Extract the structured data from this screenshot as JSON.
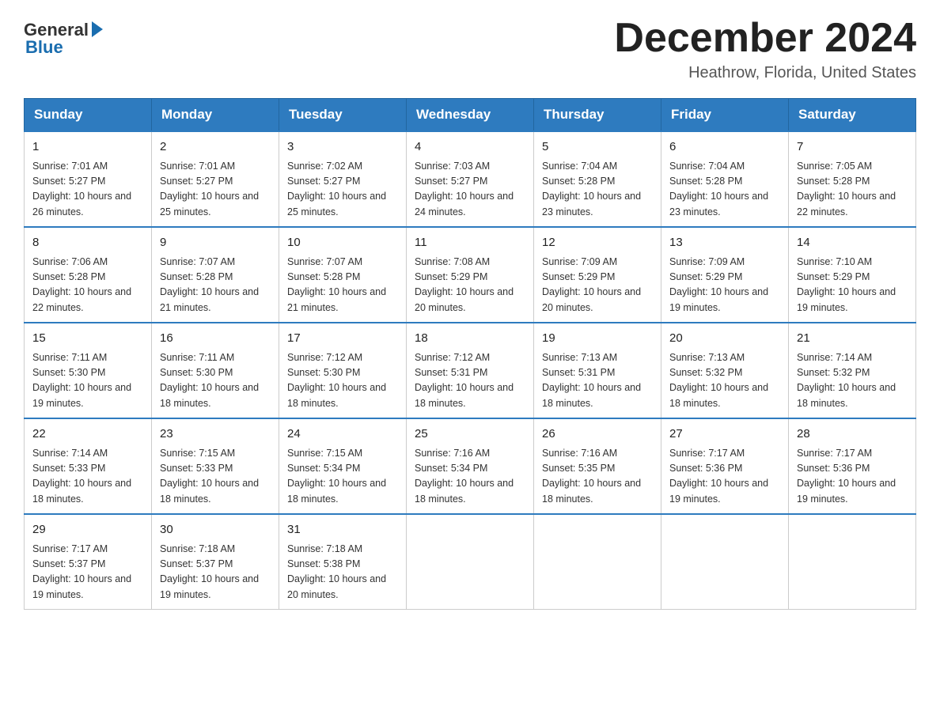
{
  "logo": {
    "general": "General",
    "blue": "Blue"
  },
  "title": {
    "month": "December 2024",
    "location": "Heathrow, Florida, United States"
  },
  "days_of_week": [
    "Sunday",
    "Monday",
    "Tuesday",
    "Wednesday",
    "Thursday",
    "Friday",
    "Saturday"
  ],
  "weeks": [
    [
      {
        "day": "1",
        "sunrise": "7:01 AM",
        "sunset": "5:27 PM",
        "daylight": "10 hours and 26 minutes."
      },
      {
        "day": "2",
        "sunrise": "7:01 AM",
        "sunset": "5:27 PM",
        "daylight": "10 hours and 25 minutes."
      },
      {
        "day": "3",
        "sunrise": "7:02 AM",
        "sunset": "5:27 PM",
        "daylight": "10 hours and 25 minutes."
      },
      {
        "day": "4",
        "sunrise": "7:03 AM",
        "sunset": "5:27 PM",
        "daylight": "10 hours and 24 minutes."
      },
      {
        "day": "5",
        "sunrise": "7:04 AM",
        "sunset": "5:28 PM",
        "daylight": "10 hours and 23 minutes."
      },
      {
        "day": "6",
        "sunrise": "7:04 AM",
        "sunset": "5:28 PM",
        "daylight": "10 hours and 23 minutes."
      },
      {
        "day": "7",
        "sunrise": "7:05 AM",
        "sunset": "5:28 PM",
        "daylight": "10 hours and 22 minutes."
      }
    ],
    [
      {
        "day": "8",
        "sunrise": "7:06 AM",
        "sunset": "5:28 PM",
        "daylight": "10 hours and 22 minutes."
      },
      {
        "day": "9",
        "sunrise": "7:07 AM",
        "sunset": "5:28 PM",
        "daylight": "10 hours and 21 minutes."
      },
      {
        "day": "10",
        "sunrise": "7:07 AM",
        "sunset": "5:28 PM",
        "daylight": "10 hours and 21 minutes."
      },
      {
        "day": "11",
        "sunrise": "7:08 AM",
        "sunset": "5:29 PM",
        "daylight": "10 hours and 20 minutes."
      },
      {
        "day": "12",
        "sunrise": "7:09 AM",
        "sunset": "5:29 PM",
        "daylight": "10 hours and 20 minutes."
      },
      {
        "day": "13",
        "sunrise": "7:09 AM",
        "sunset": "5:29 PM",
        "daylight": "10 hours and 19 minutes."
      },
      {
        "day": "14",
        "sunrise": "7:10 AM",
        "sunset": "5:29 PM",
        "daylight": "10 hours and 19 minutes."
      }
    ],
    [
      {
        "day": "15",
        "sunrise": "7:11 AM",
        "sunset": "5:30 PM",
        "daylight": "10 hours and 19 minutes."
      },
      {
        "day": "16",
        "sunrise": "7:11 AM",
        "sunset": "5:30 PM",
        "daylight": "10 hours and 18 minutes."
      },
      {
        "day": "17",
        "sunrise": "7:12 AM",
        "sunset": "5:30 PM",
        "daylight": "10 hours and 18 minutes."
      },
      {
        "day": "18",
        "sunrise": "7:12 AM",
        "sunset": "5:31 PM",
        "daylight": "10 hours and 18 minutes."
      },
      {
        "day": "19",
        "sunrise": "7:13 AM",
        "sunset": "5:31 PM",
        "daylight": "10 hours and 18 minutes."
      },
      {
        "day": "20",
        "sunrise": "7:13 AM",
        "sunset": "5:32 PM",
        "daylight": "10 hours and 18 minutes."
      },
      {
        "day": "21",
        "sunrise": "7:14 AM",
        "sunset": "5:32 PM",
        "daylight": "10 hours and 18 minutes."
      }
    ],
    [
      {
        "day": "22",
        "sunrise": "7:14 AM",
        "sunset": "5:33 PM",
        "daylight": "10 hours and 18 minutes."
      },
      {
        "day": "23",
        "sunrise": "7:15 AM",
        "sunset": "5:33 PM",
        "daylight": "10 hours and 18 minutes."
      },
      {
        "day": "24",
        "sunrise": "7:15 AM",
        "sunset": "5:34 PM",
        "daylight": "10 hours and 18 minutes."
      },
      {
        "day": "25",
        "sunrise": "7:16 AM",
        "sunset": "5:34 PM",
        "daylight": "10 hours and 18 minutes."
      },
      {
        "day": "26",
        "sunrise": "7:16 AM",
        "sunset": "5:35 PM",
        "daylight": "10 hours and 18 minutes."
      },
      {
        "day": "27",
        "sunrise": "7:17 AM",
        "sunset": "5:36 PM",
        "daylight": "10 hours and 19 minutes."
      },
      {
        "day": "28",
        "sunrise": "7:17 AM",
        "sunset": "5:36 PM",
        "daylight": "10 hours and 19 minutes."
      }
    ],
    [
      {
        "day": "29",
        "sunrise": "7:17 AM",
        "sunset": "5:37 PM",
        "daylight": "10 hours and 19 minutes."
      },
      {
        "day": "30",
        "sunrise": "7:18 AM",
        "sunset": "5:37 PM",
        "daylight": "10 hours and 19 minutes."
      },
      {
        "day": "31",
        "sunrise": "7:18 AM",
        "sunset": "5:38 PM",
        "daylight": "10 hours and 20 minutes."
      },
      null,
      null,
      null,
      null
    ]
  ]
}
